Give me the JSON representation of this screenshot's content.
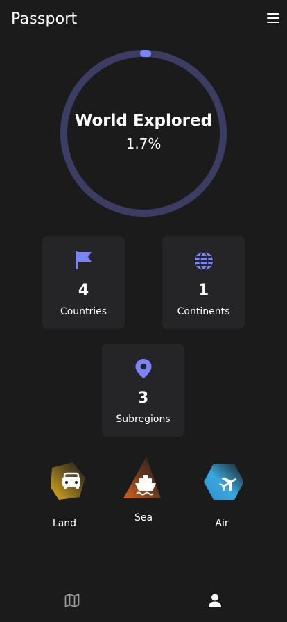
{
  "header": {
    "title": "Passport",
    "menu_icon": "hamburger-menu-icon"
  },
  "progress": {
    "label": "World Explored",
    "value_text": "1.7%",
    "fraction": 0.017,
    "track_color": "#3b3d63",
    "fill_color": "#7b84f6"
  },
  "stats": [
    {
      "icon": "flag-icon",
      "value": "4",
      "label": "Countries"
    },
    {
      "icon": "globe-icon",
      "value": "1",
      "label": "Continents"
    },
    {
      "icon": "map-pin-icon",
      "value": "3",
      "label": "Subregions"
    }
  ],
  "transport": [
    {
      "icon": "car-icon",
      "label": "Land",
      "color": "#e2b21c"
    },
    {
      "icon": "ship-icon",
      "label": "Sea",
      "color": "#d4661f"
    },
    {
      "icon": "plane-icon",
      "label": "Air",
      "color": "#3aa7dd"
    }
  ],
  "nav": [
    {
      "icon": "map-icon",
      "active": false
    },
    {
      "icon": "user-icon",
      "active": true
    }
  ],
  "colors": {
    "background": "#1b1b1b",
    "card": "#252427",
    "accent": "#7b84f6"
  }
}
